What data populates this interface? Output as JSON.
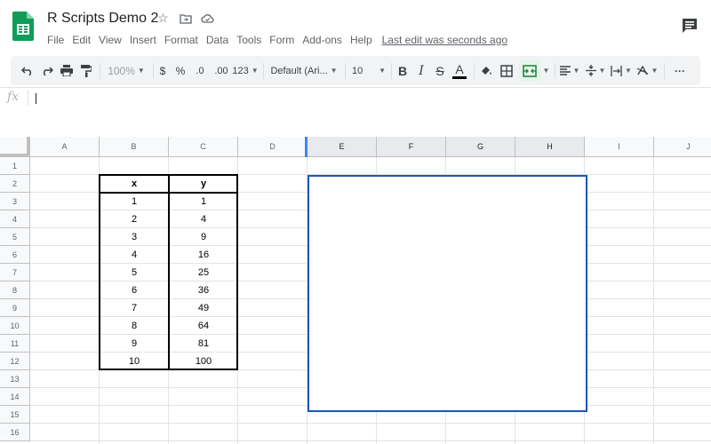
{
  "doc": {
    "title": "R Scripts Demo 2",
    "last_edit": "Last edit was seconds ago",
    "icons": [
      "star-icon",
      "move-to-folder-icon",
      "cloud-status-icon"
    ]
  },
  "menu": [
    "File",
    "Edit",
    "View",
    "Insert",
    "Format",
    "Data",
    "Tools",
    "Form",
    "Add-ons",
    "Help"
  ],
  "toolbar": {
    "zoom": "100%",
    "currency": "$",
    "percent": "%",
    "dec_less": ".0",
    "dec_more": ".00",
    "format_more": "123",
    "font": "Default (Ari...",
    "font_size": "10",
    "bold": "B",
    "italic": "I",
    "strike": "S",
    "text_color": "A",
    "more": "···"
  },
  "formula_bar": {
    "fx": "fx",
    "value": ""
  },
  "columns": [
    "A",
    "B",
    "C",
    "D",
    "E",
    "F",
    "G",
    "H",
    "I",
    "J"
  ],
  "rows": [
    "1",
    "2",
    "3",
    "4",
    "5",
    "6",
    "7",
    "8",
    "9",
    "10",
    "11",
    "12",
    "13",
    "14",
    "15",
    "16"
  ],
  "table": {
    "headers": [
      "x",
      "y"
    ],
    "x": [
      "1",
      "2",
      "3",
      "4",
      "5",
      "6",
      "7",
      "8",
      "9",
      "10"
    ],
    "y": [
      "1",
      "4",
      "9",
      "16",
      "25",
      "36",
      "49",
      "64",
      "81",
      "100"
    ]
  },
  "colors": {
    "sheets_green": "#0f9d58",
    "selection_blue": "#1a56b8",
    "header_bg": "#f8f9fa"
  }
}
